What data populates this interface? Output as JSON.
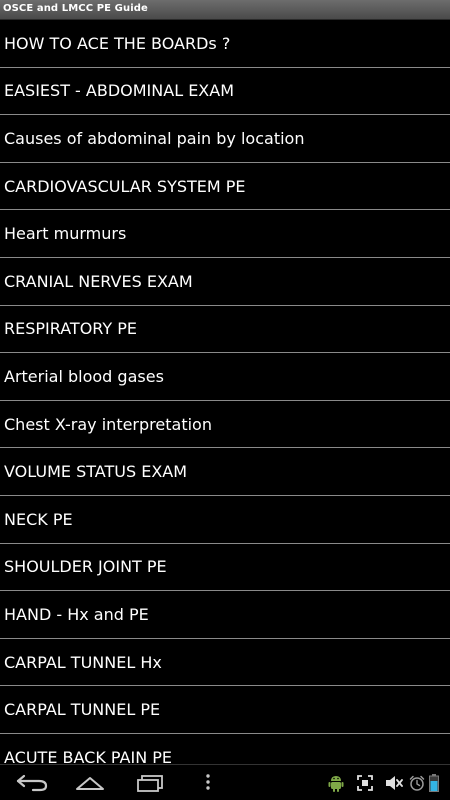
{
  "app": {
    "title": "OSCE and LMCC PE Guide"
  },
  "menu": {
    "items": [
      {
        "label": "HOW TO ACE THE BOARDs ?"
      },
      {
        "label": "EASIEST - ABDOMINAL EXAM"
      },
      {
        "label": "Causes of abdominal pain by location"
      },
      {
        "label": "CARDIOVASCULAR SYSTEM PE"
      },
      {
        "label": "Heart murmurs"
      },
      {
        "label": "CRANIAL NERVES EXAM"
      },
      {
        "label": "RESPIRATORY PE"
      },
      {
        "label": "Arterial blood gases"
      },
      {
        "label": "Chest X-ray interpretation"
      },
      {
        "label": "VOLUME STATUS EXAM"
      },
      {
        "label": "NECK PE"
      },
      {
        "label": "SHOULDER JOINT PE"
      },
      {
        "label": "HAND - Hx and PE"
      },
      {
        "label": "CARPAL TUNNEL Hx"
      },
      {
        "label": "CARPAL TUNNEL PE"
      },
      {
        "label": "ACUTE BACK PAIN PE"
      }
    ]
  },
  "navbar": {
    "icons": [
      "back-icon",
      "home-icon",
      "recent-apps-icon",
      "overflow-menu-icon"
    ],
    "status_icons": [
      "android-debug-icon",
      "screenshot-icon",
      "volume-muted-icon",
      "alarm-icon",
      "battery-icon"
    ]
  },
  "colors": {
    "background": "#000000",
    "title_bar": "#5a5a5a",
    "divider": "#8a8a8a",
    "text": "#ffffff",
    "icon": "#c8c8c8",
    "android_green": "#7fa848",
    "battery": "#33b5e5"
  }
}
